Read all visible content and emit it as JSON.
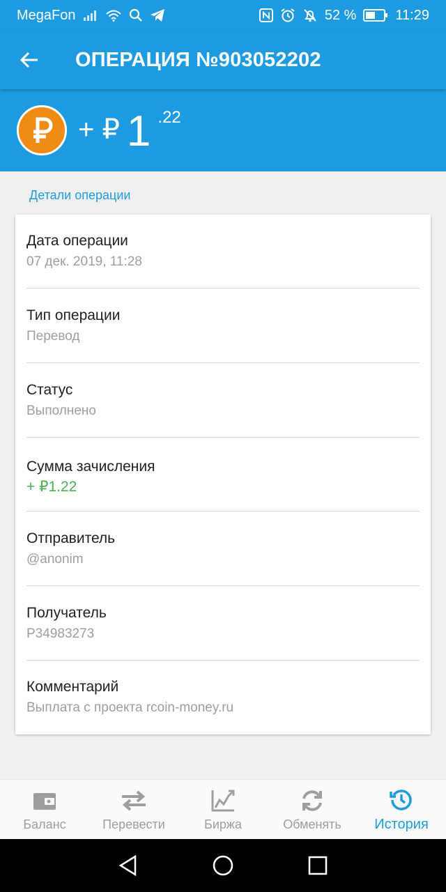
{
  "status_bar": {
    "carrier": "MegaFon",
    "battery": "52 %",
    "time": "11:29"
  },
  "app_bar": {
    "title": "ОПЕРАЦИЯ №903052202"
  },
  "amount": {
    "sign": "+ ₽",
    "integer": "1",
    "cents": ".22"
  },
  "section": {
    "label": "Детали операции"
  },
  "details": [
    {
      "label": "Дата операции",
      "value": "07 дек. 2019, 11:28"
    },
    {
      "label": "Тип операции",
      "value": "Перевод"
    },
    {
      "label": "Статус",
      "value": "Выполнено"
    },
    {
      "label": "Сумма зачисления",
      "value": "+ ₽1.22"
    },
    {
      "label": "Отправитель",
      "value": "@anonim"
    },
    {
      "label": "Получатель",
      "value": "P34983273"
    },
    {
      "label": "Комментарий",
      "value": "Выплата с проекта rcoin-money.ru"
    }
  ],
  "bottom_nav": {
    "items": [
      {
        "label": "Баланс",
        "icon": "wallet-icon"
      },
      {
        "label": "Перевести",
        "icon": "transfer-arrows-icon"
      },
      {
        "label": "Биржа",
        "icon": "chart-icon"
      },
      {
        "label": "Обменять",
        "icon": "exchange-refresh-icon"
      },
      {
        "label": "История",
        "icon": "history-icon"
      }
    ],
    "active_index": 4
  },
  "colors": {
    "accent": "#1e9be0",
    "coin": "#ef8a13",
    "positive": "#4caf50",
    "secondary_text": "#9e9e9e"
  }
}
